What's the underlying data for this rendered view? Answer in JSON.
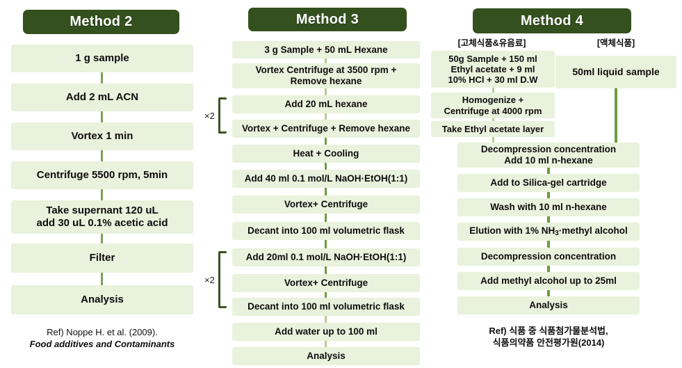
{
  "methods": [
    {
      "id": "method-2",
      "title": "Method 2",
      "steps": [
        {
          "text": "1 g sample"
        },
        {
          "text": "Add 2 mL ACN"
        },
        {
          "text": "Vortex 1 min"
        },
        {
          "text": "Centrifuge 5500 rpm, 5min"
        },
        {
          "line1": "Take supernant 120 uL",
          "line2": "add 30 uL 0.1% acetic acid"
        },
        {
          "text": "Filter"
        },
        {
          "text": "Analysis"
        }
      ],
      "reference": {
        "line1": "Ref) Noppe H. et al. (2009).",
        "line2": "Food additives and Contaminants"
      }
    },
    {
      "id": "method-3",
      "title": "Method 3",
      "steps": [
        {
          "text": "3 g Sample + 50 mL Hexane"
        },
        {
          "line1": "Vortex Centrifuge at 3500 rpm +",
          "line2": "Remove hexane"
        },
        {
          "text": "Add 20 mL hexane"
        },
        {
          "text": "Vortex + Centrifuge + Remove hexane"
        },
        {
          "text": "Heat + Cooling"
        },
        {
          "text": "Add 40 ml 0.1 mol/L NaOH·EtOH(1:1)"
        },
        {
          "text": "Vortex+ Centrifuge"
        },
        {
          "text": "Decant into 100 ml volumetric flask"
        },
        {
          "text": "Add 20ml 0.1 mol/L NaOH·EtOH(1:1)"
        },
        {
          "text": "Vortex+ Centrifuge"
        },
        {
          "text": "Decant into 100 ml volumetric flask"
        },
        {
          "text": "Add water up to 100 ml"
        },
        {
          "text": "Analysis"
        }
      ],
      "repeat_brackets": [
        {
          "label": "×2"
        },
        {
          "label": "×2"
        }
      ]
    },
    {
      "id": "method-4",
      "title": "Method 4",
      "column_labels": {
        "left": "[고체식품&유음료]",
        "right": "[액체식품]"
      },
      "left_steps": [
        {
          "line1": "50g Sample + 150 ml",
          "line2": "Ethyl acetate + 9 ml",
          "line3": "10% HCl + 30 ml D.W"
        },
        {
          "line1": "Homogenize +",
          "line2": "Centrifuge at 4000 rpm"
        },
        {
          "text": "Take Ethyl acetate layer"
        }
      ],
      "right_steps": [
        {
          "text": "50ml liquid sample"
        }
      ],
      "merged_steps": [
        {
          "line1": "Decompression concentration",
          "line2": "Add 10 ml n-hexane"
        },
        {
          "text": "Add to Silica-gel cartridge"
        },
        {
          "text": "Wash with 10 ml n-hexane"
        },
        {
          "html": "elution",
          "text": "Elution with 1% NH3·methyl alcohol"
        },
        {
          "text": "Decompression concentration"
        },
        {
          "text": "Add methyl alcohol up to 25ml"
        },
        {
          "text": "Analysis"
        }
      ],
      "reference": {
        "line1": "Ref) 식품 중 식품첨가물분석법,",
        "line2": "식품의약품 안전평가원(2014)"
      }
    }
  ],
  "colors": {
    "header_green": "#33501e",
    "box_green": "#e9f2dc",
    "connector_green": "#7da34f",
    "bracket_green": "#3c5320",
    "text": "#0d0d0d"
  }
}
